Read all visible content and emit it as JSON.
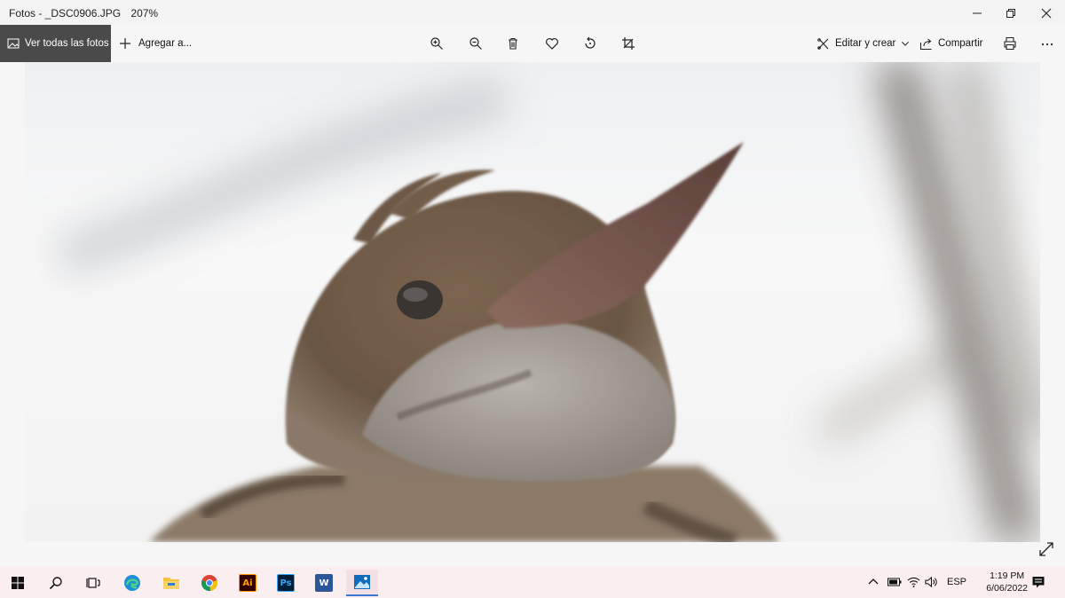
{
  "window": {
    "title": "Fotos - _DSC0906.JPG",
    "zoom": "207%"
  },
  "toolbar": {
    "all_photos": "Ver todas las fotos",
    "add_to": "Agregar a...",
    "edit_create": "Editar y crear",
    "share": "Compartir",
    "tools": [
      "zoom-in",
      "zoom-out",
      "delete",
      "favorite",
      "rotate",
      "crop"
    ]
  },
  "taskbar": {
    "apps": [
      "start",
      "search",
      "task-view",
      "edge",
      "file-explorer",
      "chrome",
      "illustrator",
      "photoshop",
      "word",
      "photos"
    ],
    "illustrator_label": "Ai",
    "photoshop_label": "Ps",
    "word_label": "W",
    "language": "ESP",
    "time": "1:19 PM",
    "date": "6/06/2022"
  },
  "colors": {
    "accent": "#3b78d0",
    "taskbar_bg": "#fbeef0",
    "active_nav": "#4a4a4a"
  }
}
